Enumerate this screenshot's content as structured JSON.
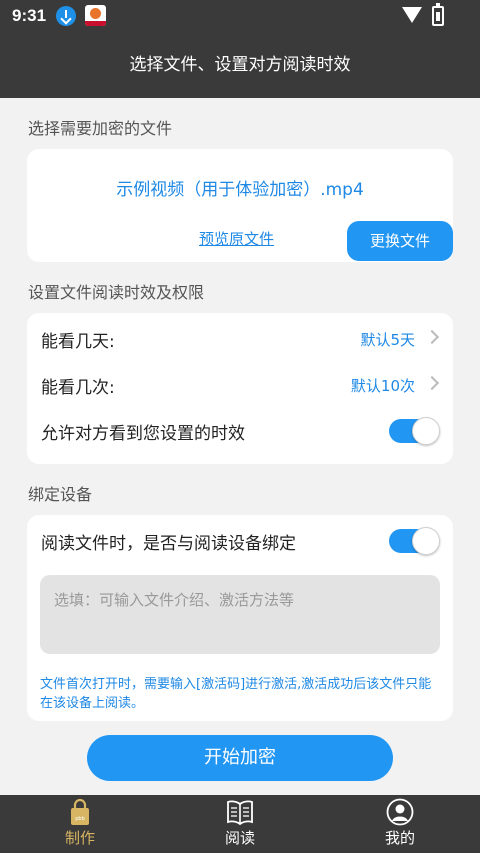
{
  "status_bar": {
    "time": "9:31"
  },
  "header": {
    "title": "选择文件、设置对方阅读时效"
  },
  "file_section": {
    "label": "选择需要加密的文件",
    "file_name": "示例视频（用于体验加密）.mp4",
    "preview_label": "预览原文件",
    "change_label": "更换文件"
  },
  "limits_section": {
    "label": "设置文件阅读时效及权限",
    "days_label": "能看几天:",
    "days_value": "默认5天",
    "times_label": "能看几次:",
    "times_value": "默认10次",
    "allow_label": "允许对方看到您设置的时效",
    "allow_on": true
  },
  "device_section": {
    "label": "绑定设备",
    "bind_label": "阅读文件时，是否与阅读设备绑定",
    "bind_on": true,
    "note_placeholder": "选填：可输入文件介绍、激活方法等",
    "hint": "文件首次打开时，需要输入[激活码]进行激活,激活成功后该文件只能在该设备上阅读。"
  },
  "primary_button": "开始加密",
  "bottom_nav": [
    {
      "label": "制作",
      "icon": "lock-bag-icon",
      "active": true
    },
    {
      "label": "阅读",
      "icon": "book-icon",
      "active": false
    },
    {
      "label": "我的",
      "icon": "user-icon",
      "active": false
    }
  ],
  "colors": {
    "accent": "#2196f3",
    "link": "#1e88e5",
    "bar": "#3a3a3a",
    "nav_active": "#d8b562"
  }
}
